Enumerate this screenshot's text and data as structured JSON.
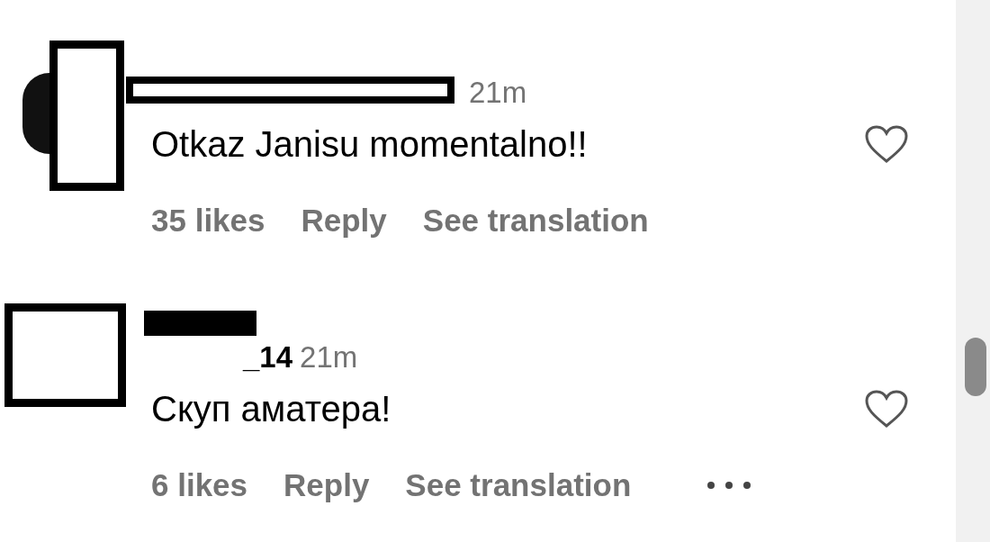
{
  "comments": [
    {
      "time": "21m",
      "text": "Otkaz Janisu momentalno!!",
      "likes": "35 likes",
      "reply": "Reply",
      "translate": "See translation",
      "liked": false,
      "more_button": false,
      "redacted": true
    },
    {
      "username": "_14",
      "time": "21m",
      "text": "Скуп аматера!",
      "likes": "6 likes",
      "reply": "Reply",
      "translate": "See translation",
      "liked": false,
      "more_button": true,
      "redacted": true
    }
  ]
}
